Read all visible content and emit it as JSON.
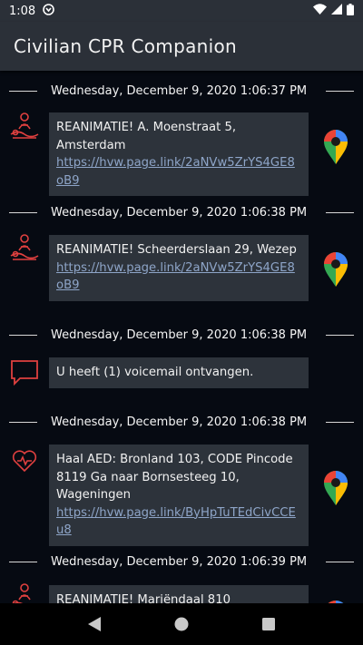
{
  "status_bar": {
    "time": "1:08"
  },
  "app_bar": {
    "title": "Civilian CPR Companion"
  },
  "messages": [
    {
      "date": "Wednesday, December 9, 2020 1:06:37 PM",
      "icon": "cpr-icon",
      "text": "REANIMATIE! A. Moenstraat 5, Amsterdam ",
      "link": "https://hvw.page.link/2aNVw5ZrYS4GE8oB9",
      "has_map": true
    },
    {
      "date": "Wednesday, December 9, 2020 1:06:38 PM",
      "icon": "cpr-icon",
      "text": "REANIMATIE! Scheerderslaan 29, Wezep ",
      "link": "https://hvw.page.link/2aNVw5ZrYS4GE8oB9",
      "has_map": true
    },
    {
      "date": "Wednesday, December 9, 2020 1:06:38 PM",
      "icon": "chat-bubble-icon",
      "text": "U heeft (1) voicemail ontvangen.",
      "link": "",
      "has_map": false
    },
    {
      "date": "Wednesday, December 9, 2020 1:06:38 PM",
      "icon": "heart-aed-icon",
      "text": "Haal AED: Bronland 103, CODE Pincode 8119 Ga naar Bornsesteeg 10, Wageningen ",
      "link": "https://hvw.page.link/ByHpTuTEdCivCCEu8",
      "has_map": true
    },
    {
      "date": "Wednesday, December 9, 2020 1:06:39 PM",
      "icon": "cpr-icon",
      "text": "REANIMATIE! Mariëndaal 810",
      "link": "",
      "has_map": true
    }
  ],
  "colors": {
    "accent_red": "#e0403f",
    "bubble": "#2d333b",
    "background": "#060a12",
    "link": "#8ea5c8"
  }
}
